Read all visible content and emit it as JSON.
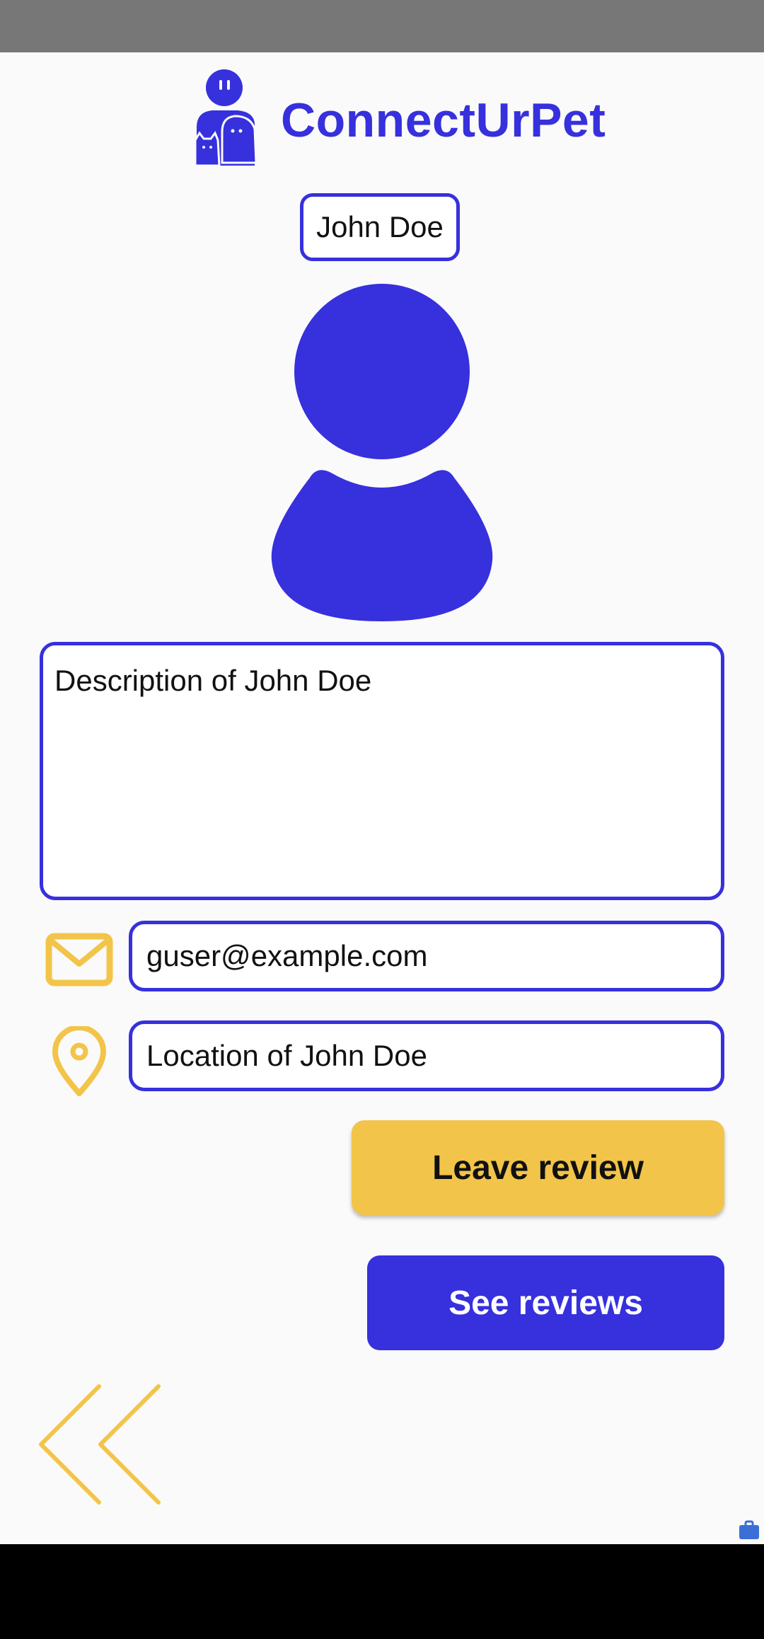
{
  "app": {
    "title": "ConnectUrPet",
    "brand_color": "#3730dd",
    "accent_color": "#f2c449"
  },
  "profile": {
    "name": "John Doe",
    "description": "Description of John Doe",
    "email": "guser@example.com",
    "location": "Location of John Doe"
  },
  "actions": {
    "leave_review_label": "Leave review",
    "see_reviews_label": "See reviews"
  },
  "icons": {
    "logo": "person-with-pets-logo",
    "avatar": "user-avatar-icon",
    "email": "envelope-icon",
    "location": "map-pin-icon",
    "back": "double-chevron-left-icon"
  }
}
